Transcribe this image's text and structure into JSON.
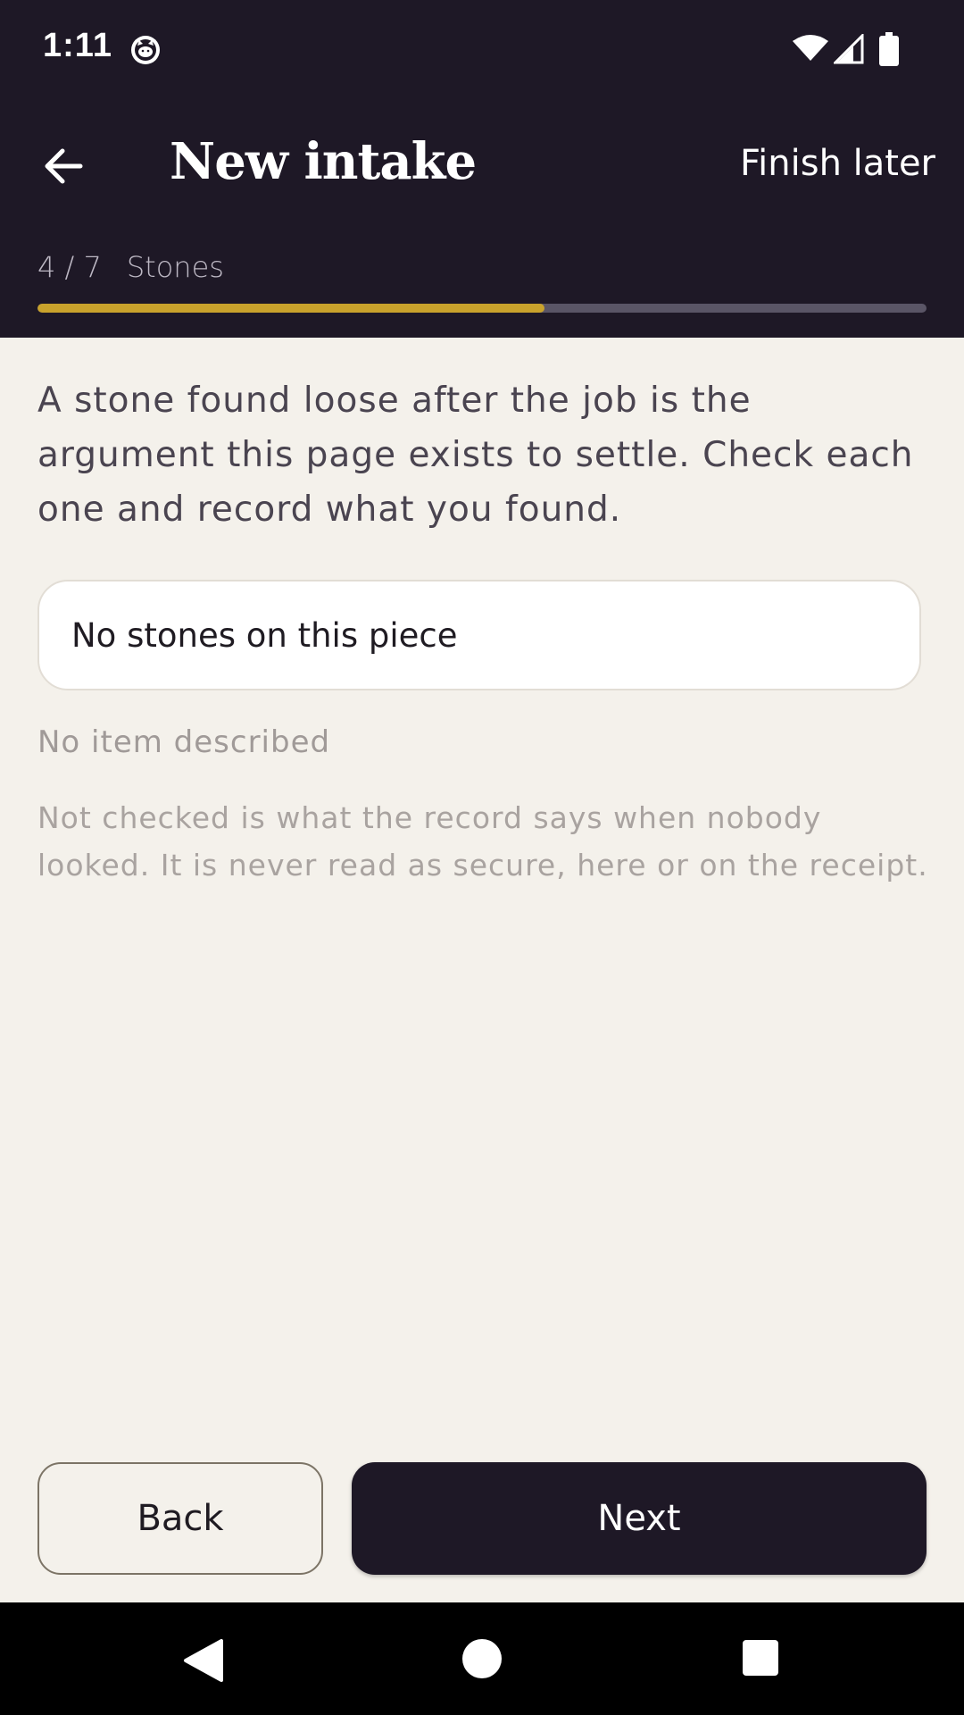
{
  "status_bar": {
    "time": "1:11",
    "app_icon": "cat-face-icon",
    "wifi_icon": "wifi-icon",
    "signal_icon": "cell-signal-icon",
    "battery_icon": "battery-icon"
  },
  "app_bar": {
    "back_icon": "arrow-left-icon",
    "title": "New intake",
    "finish_later_label": "Finish later"
  },
  "step": {
    "position": "4 / 7",
    "name": "Stones",
    "progress_fraction": 0.57
  },
  "content": {
    "intro": "A stone found loose after the job is the argument this page exists to settle. Check each one and record what you found.",
    "stone_option_label": "No stones on this piece",
    "no_item_text": "No item described",
    "note": "Not checked is what the record says when nobody looked. It is never read as secure, here or on the receipt."
  },
  "actions": {
    "back_label": "Back",
    "next_label": "Next"
  },
  "nav_bar": {
    "back_icon": "nav-back-triangle-icon",
    "home_icon": "nav-home-circle-icon",
    "recents_icon": "nav-recents-square-icon"
  },
  "colors": {
    "header_bg": "#1e1826",
    "page_bg": "#f4f1eb",
    "progress_accent": "#c9a22c",
    "progress_track": "#5a5566",
    "primary_button": "#1e1826"
  }
}
